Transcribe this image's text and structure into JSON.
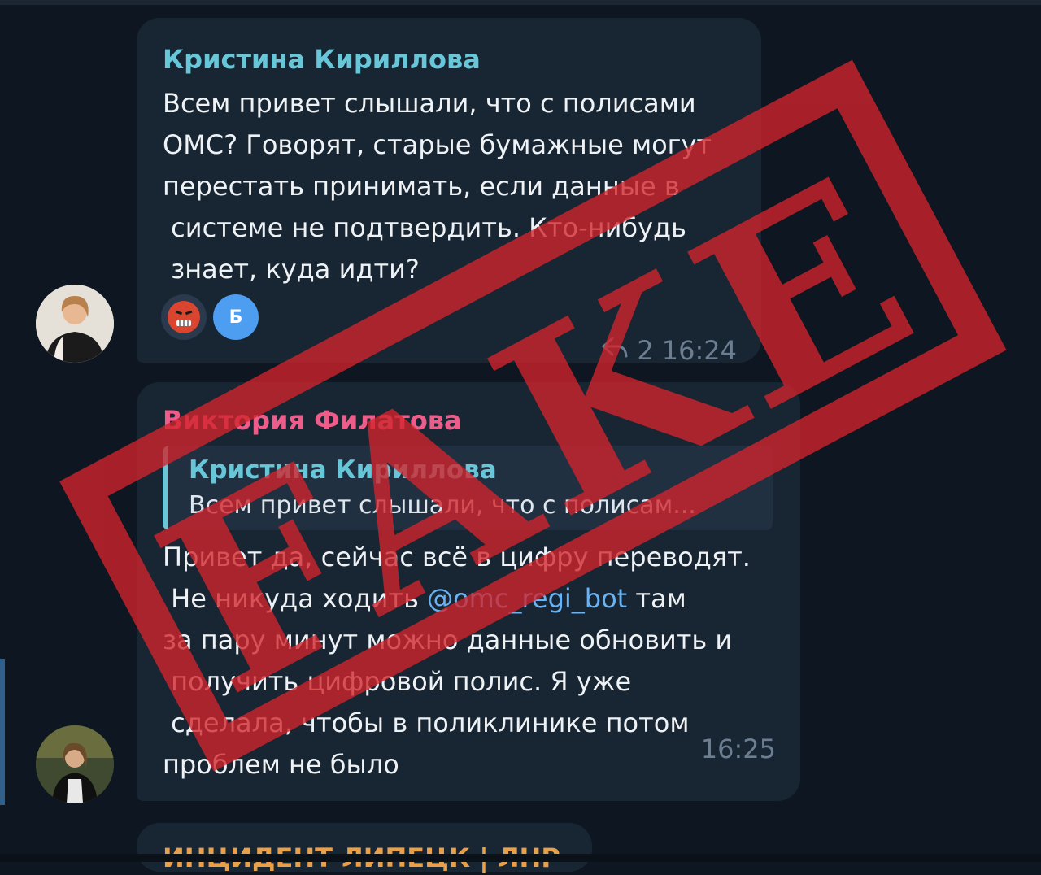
{
  "messages": [
    {
      "sender": "Кристина Кириллова",
      "lines": [
        "Всем привет слышали, что с полисами",
        "ОМС? Говорят, старые бумажные могут",
        "перестать принимать, если данные в",
        " системе не подтвердить. Кто-нибудь",
        " знает, куда идти?"
      ],
      "reactions": {
        "avatar_letter": "Б"
      },
      "replies": "2",
      "time": "16:24"
    },
    {
      "sender": "Виктория Филатова",
      "reply": {
        "name": "Кристина Кириллова",
        "text": "Всем привет слышали, что с полисам..."
      },
      "lines": [
        "Привет да, сейчас всё в цифру переводят.",
        " Не никуда ходить ",
        "за пару минут можно данные обновить и",
        " получить цифровой полис. Я уже",
        " сделала, чтобы в поликлинике потом",
        "проблем не было"
      ],
      "mention": "@omc_regi_bot",
      "line2_end": " там",
      "time": "16:25"
    },
    {
      "sender": "ИНЦИДЕНТ ЛИПЕЦК | ЛНР"
    }
  ],
  "stamp": {
    "text": "FAKE",
    "color": "#d3242c"
  },
  "icons": {
    "reply": "reply-arrow-icon",
    "reaction": "angry-face-icon"
  }
}
